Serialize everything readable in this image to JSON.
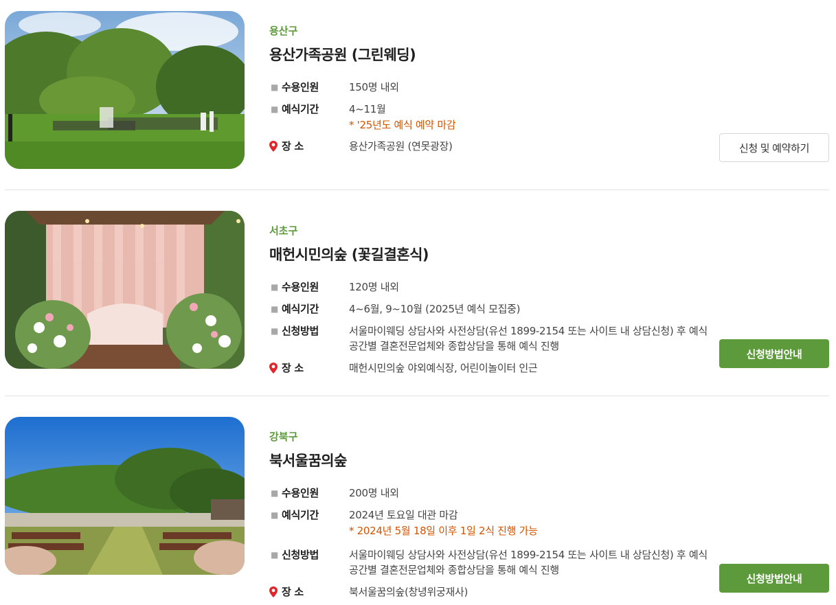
{
  "venues": [
    {
      "district": "용산구",
      "name": "용산가족공원 (그린웨딩)",
      "capacity_label": "수용인원",
      "capacity": "150명 내외",
      "period_label": "예식기간",
      "period": "4~11월",
      "period_note": "* '25년도 예식 예약 마감",
      "place_label": "장 소",
      "place": "용산가족공원 (연못광장)",
      "button": "신청 및 예약하기"
    },
    {
      "district": "서초구",
      "name": "매헌시민의숲 (꽃길결혼식)",
      "capacity_label": "수용인원",
      "capacity": "120명 내외",
      "period_label": "예식기간",
      "period": "4~6월, 9~10월 (2025년 예식 모집중)",
      "method_label": "신청방법",
      "method": "서울마이웨딩 상담사와 사전상담(유선 1899-2154 또는 사이트 내 상담신청) 후 예식 공간별 결혼전문업체와 종합상담을 통해 예식 진행",
      "place_label": "장 소",
      "place": "매헌시민의숲 야외예식장, 어린이놀이터 인근",
      "button": "신청방법안내"
    },
    {
      "district": "강북구",
      "name": "북서울꿈의숲",
      "capacity_label": "수용인원",
      "capacity": "200명 내외",
      "period_label": "예식기간",
      "period": "2024년 토요일 대관 마감",
      "period_note": "* 2024년 5월 18일 이후 1일 2식 진행 가능",
      "method_label": "신청방법",
      "method": "서울마이웨딩 상담사와 사전상담(유선 1899-2154 또는 사이트 내 상담신청) 후 예식 공간별 결혼전문업체와 종합상담을 통해 예식 진행",
      "place_label": "장 소",
      "place": "북서울꿈의숲(창녕위궁재사)",
      "button": "신청방법안내"
    }
  ],
  "colors": {
    "district": "#5e9a3d",
    "note": "#d35400",
    "button_green": "#5c9a3b",
    "pin": "#e0262a"
  },
  "icons": {
    "bullet": "square-bullet-icon",
    "place": "location-pin-icon"
  }
}
